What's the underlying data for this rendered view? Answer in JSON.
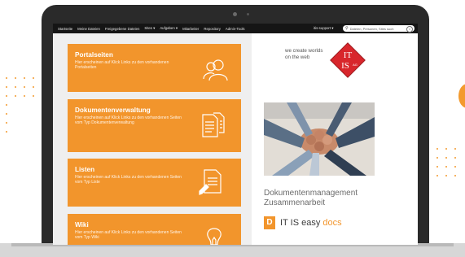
{
  "nav": {
    "items": [
      "Startseite",
      "Meine Dateien",
      "Freigegebene Dateien",
      "Sites ▾",
      "Aufgaben ▾",
      "Mitarbeiter",
      "Repository",
      "Admin-Tools"
    ],
    "user": "itis-support ▾",
    "search_placeholder": "Dateien, Personen, Sites such"
  },
  "tiles": [
    {
      "title": "Portalseiten",
      "desc": "Hier erscheinen auf Klick Links zu den vorhandenen Portalseiten",
      "icon": "people-icon"
    },
    {
      "title": "Dokumentenverwaltung",
      "desc": "Hier erscheinen auf Klick Links zu den vorhandenen Seiten vom Typ Dokumentenverwaltung",
      "icon": "documents-icon"
    },
    {
      "title": "Listen",
      "desc": "Hier erscheinen auf Klick Links zu den vorhandenen Seiten vom Typ Liste",
      "icon": "list-document-icon"
    },
    {
      "title": "Wiki",
      "desc": "Hier erscheinen auf Klick Links zu den vorhandenen Seiten vom Typ Wiki",
      "icon": "lightbulb-icon"
    }
  ],
  "sidebar": {
    "tagline1": "we create worlds",
    "tagline2": "on the web",
    "logo": {
      "l1": "IT",
      "l2": "IS",
      "ag": "AG"
    },
    "heading1": "Dokumentenmanagement",
    "heading2": "Zusammenarbeit",
    "brand": {
      "mark": "D",
      "name": "IT IS easy",
      "accent": "docs"
    }
  },
  "colors": {
    "accent": "#f2952c",
    "nav": "#151515",
    "logo_red": "#d8262c"
  }
}
